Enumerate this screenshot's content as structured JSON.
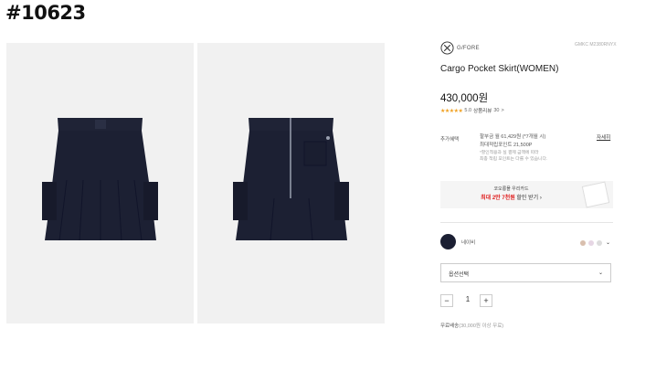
{
  "page_id": "#10623",
  "brand": {
    "name": "G/FORE",
    "logo_icon": "gfore-cross-logo-icon"
  },
  "product": {
    "code": "GMKC M2380RNYX",
    "title": "Cargo Pocket Skirt(WOMEN)",
    "price": "430,000원",
    "stars": "★★★★★",
    "rating_score": "5.0",
    "review_label": "상품리뷰",
    "review_count": "30",
    "review_suffix": ">"
  },
  "images": {
    "front": {
      "alt": "skirt-front",
      "color": "#1b1f33"
    },
    "back": {
      "alt": "skirt-back",
      "color": "#1b1f33"
    }
  },
  "points": {
    "label": "추가혜택",
    "line1": "할부금 월 61,429원 (*7개월 시)",
    "line2": "최대적립포인트 21,500P",
    "note1": "*할인적용과 실 결제 금액에 따라",
    "note2": "최종 적립 포인트는 다를 수 있습니다.",
    "detail_link": "자세히"
  },
  "banner": {
    "line1": "코오롱몰 우리카드",
    "highlight": "최대 2만 7천원",
    "line2_rest": " 할인 받기",
    "arrow": "›"
  },
  "color": {
    "selected_name": "네이비",
    "selected_hex": "#1b1f33",
    "other_hex": [
      "#d9bfae",
      "#e6d6e4",
      "#dcdcdc"
    ],
    "dropdown_icon": "chevron-down-icon"
  },
  "option_select": {
    "placeholder": "옵션선택",
    "chevron": "⌄"
  },
  "quantity": {
    "minus": "−",
    "value": "1",
    "plus": "+"
  },
  "shipping": {
    "prefix": "무료배송",
    "detail": "(30,000원 이상 무료)"
  }
}
